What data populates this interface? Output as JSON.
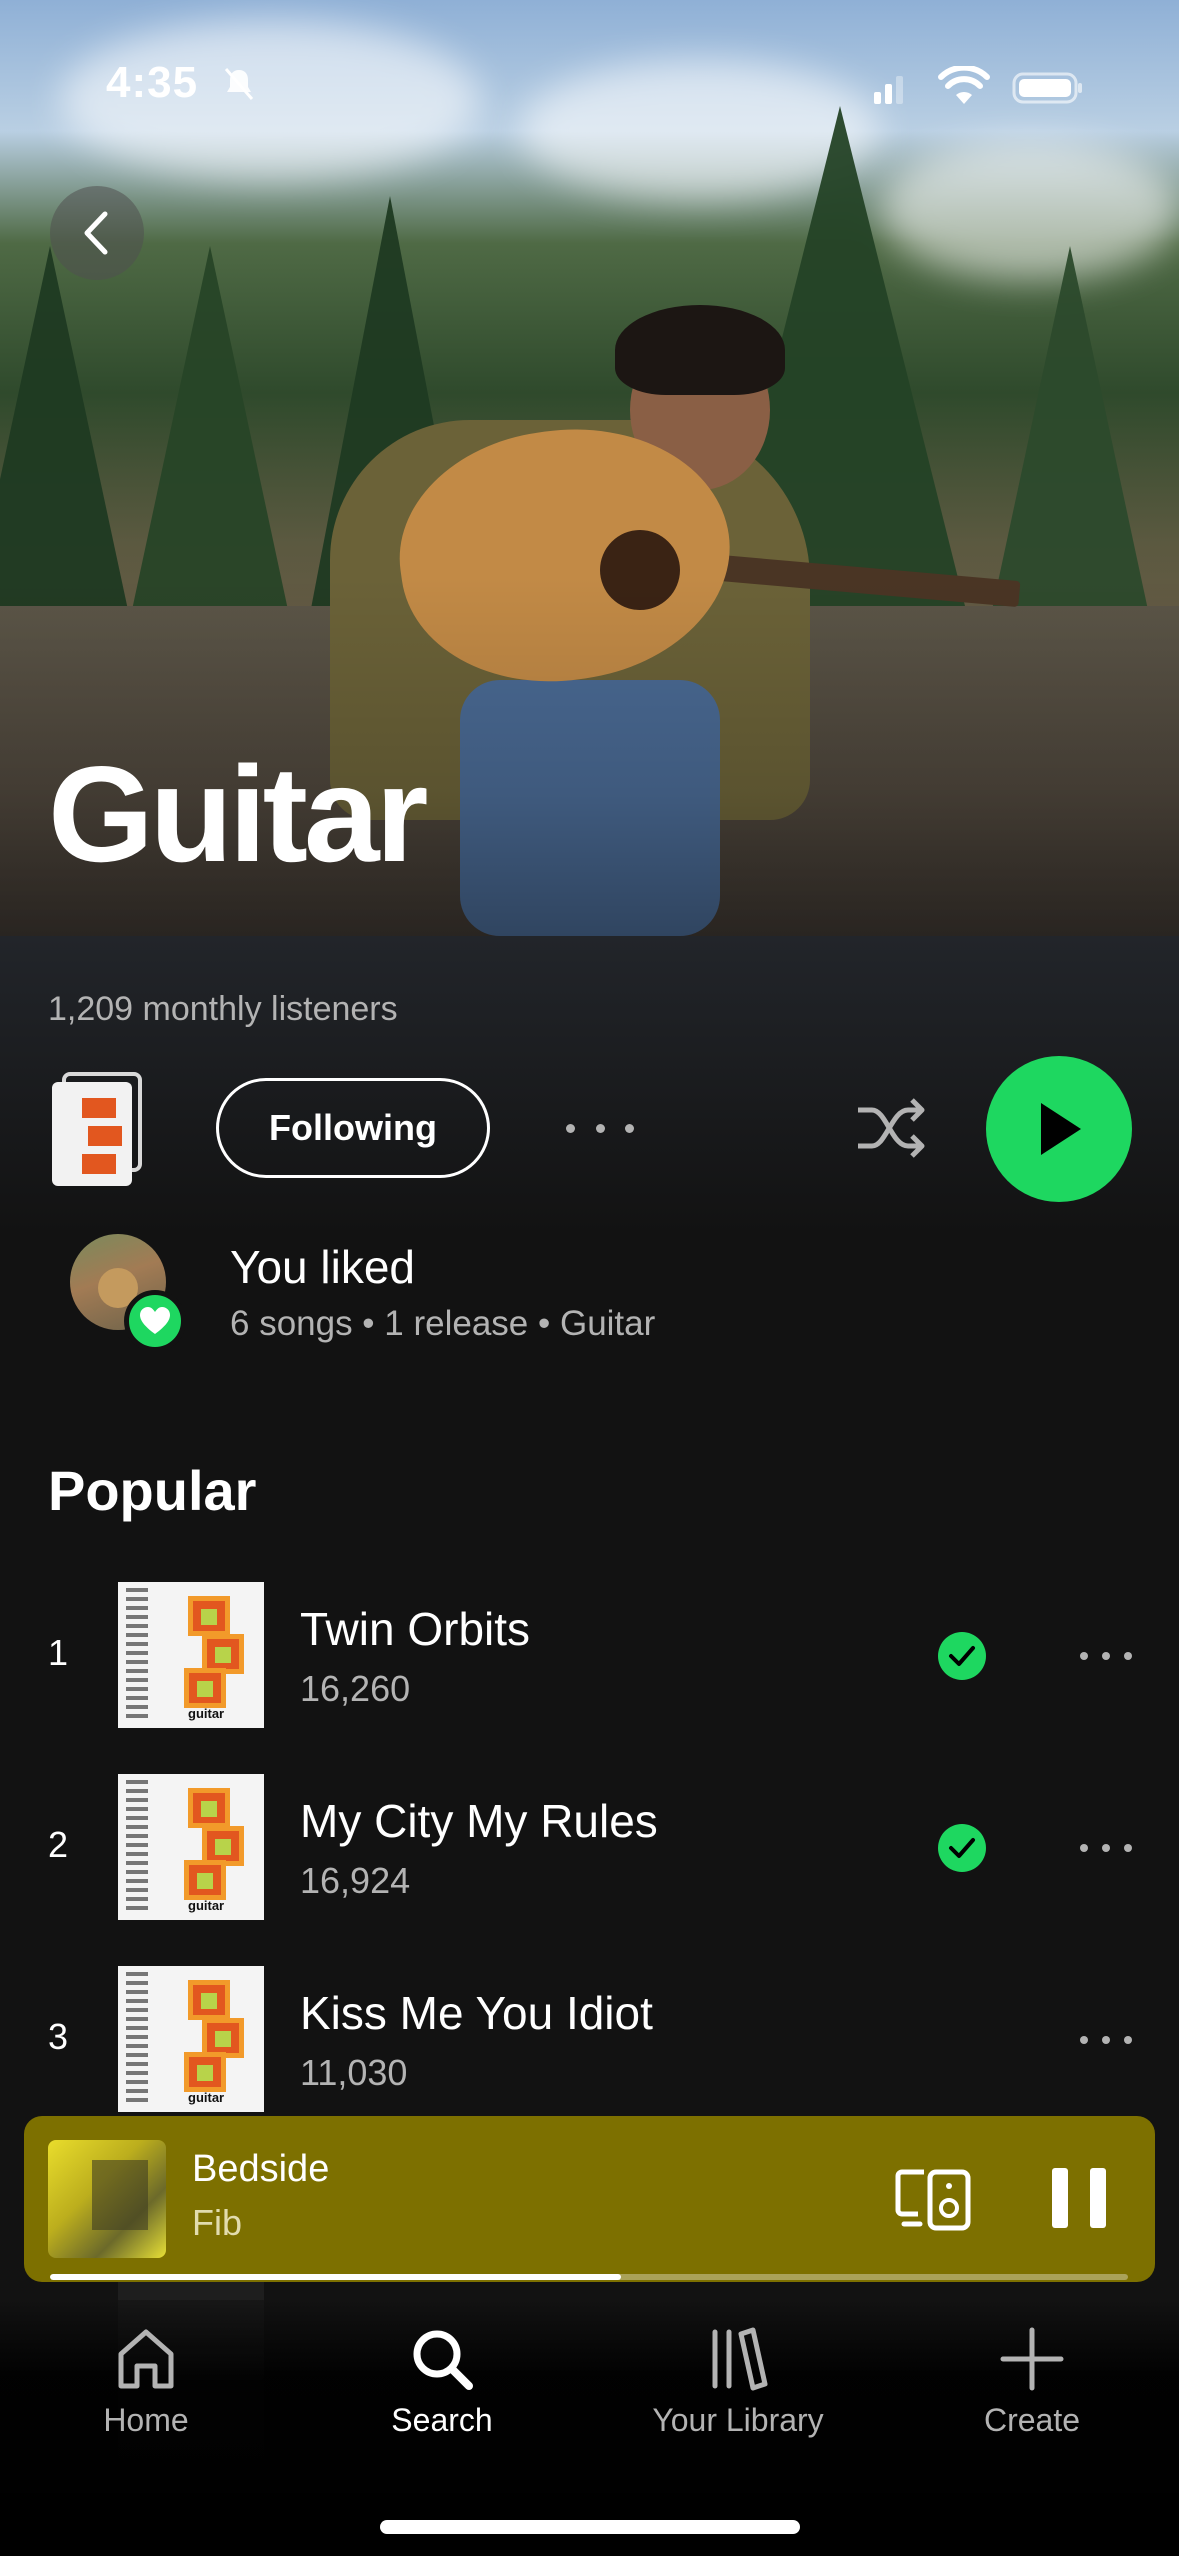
{
  "status_bar": {
    "time": "4:35"
  },
  "artist": {
    "name": "Guitar",
    "monthly_listeners": "1,209 monthly listeners"
  },
  "actions": {
    "follow_label": "Following"
  },
  "liked": {
    "title": "You liked",
    "subtitle": "6 songs • 1 release • Guitar"
  },
  "section_title": "Popular",
  "tracks": [
    {
      "rank": "1",
      "title": "Twin Orbits",
      "plays": "16,260",
      "downloaded": true
    },
    {
      "rank": "2",
      "title": "My City My Rules",
      "plays": "16,924",
      "downloaded": true
    },
    {
      "rank": "3",
      "title": "Kiss Me You Idiot",
      "plays": "11,030",
      "downloaded": false
    }
  ],
  "now_playing": {
    "title": "Bedside",
    "artist": "Fib",
    "progress": 0.53,
    "bar_color": "#7d7000"
  },
  "nav": [
    {
      "label": "Home",
      "icon": "home-icon",
      "active": false
    },
    {
      "label": "Search",
      "icon": "search-icon",
      "active": true
    },
    {
      "label": "Your Library",
      "icon": "library-icon",
      "active": false
    },
    {
      "label": "Create",
      "icon": "plus-icon",
      "active": false
    }
  ],
  "colors": {
    "accent": "#1ed760",
    "background": "#121212"
  }
}
